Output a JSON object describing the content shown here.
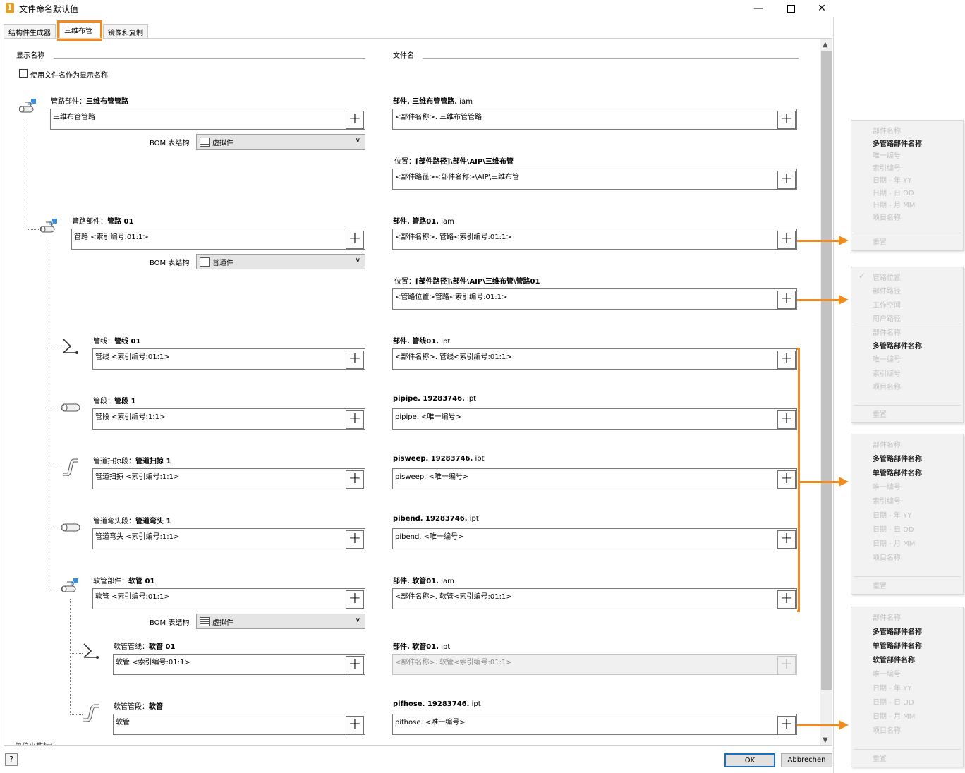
{
  "window": {
    "title": "文件命名默认值"
  },
  "tabs": [
    "结构件生成器",
    "三维布管",
    "镜像和复制"
  ],
  "header": {
    "display_name": "显示名称",
    "file_name": "文件名"
  },
  "use_filename_checkbox": "使用文件名作为显示名称",
  "rows": [
    {
      "label": "管路部件：",
      "label_bold": "三维布管管路",
      "value": "三维布管管路",
      "file_label": "部件. 三维布管管路.",
      "file_ext": "iam",
      "file_value": "<部件名称>. 三维布管管路",
      "icon": "assembly-icon"
    },
    {
      "label": "管路部件：",
      "label_bold": "管路 01",
      "value": "管路 <索引编号:01:1>",
      "file_label": "部件. 管路01.",
      "file_ext": "iam",
      "file_value": "<部件名称>. 管路<索引编号:01:1>",
      "icon": "assembly-icon"
    },
    {
      "label": "管线：",
      "label_bold": "管线 01",
      "value": "管线 <索引编号:01:1>",
      "file_label": "部件. 管线01.",
      "file_ext": "ipt",
      "file_value": "<部件名称>. 管线<索引编号:01:1>",
      "icon": "route-icon"
    },
    {
      "label": "管段：",
      "label_bold": "管段 1",
      "value": "管段 <索引编号:1:1>",
      "file_label": "pipipe. 19283746.",
      "file_ext": "ipt",
      "file_value": "pipipe. <唯一编号>",
      "icon": "pipe-icon"
    },
    {
      "label": "管道扫掠段：",
      "label_bold": "管道扫掠 1",
      "value": "管道扫掠 <索引编号:1:1>",
      "file_label": "pisweep. 19283746.",
      "file_ext": "ipt",
      "file_value": "pisweep. <唯一编号>",
      "icon": "sweep-icon"
    },
    {
      "label": "管道弯头段：",
      "label_bold": "管道弯头 1",
      "value": "管道弯头 <索引编号:1:1>",
      "file_label": "pibend. 19283746.",
      "file_ext": "ipt",
      "file_value": "pibend. <唯一编号>",
      "icon": "pipe-icon"
    },
    {
      "label": "软管部件：",
      "label_bold": "软管 01",
      "value": "软管 <索引编号:01:1>",
      "file_label": "部件. 软管01.",
      "file_ext": "iam",
      "file_value": "<部件名称>. 软管<索引编号:01:1>",
      "icon": "assembly-icon"
    },
    {
      "label": "软管管线：",
      "label_bold": "软管 01",
      "value": "软管 <索引编号:01:1>",
      "file_label": "部件. 软管01.",
      "file_ext": "ipt",
      "file_value": "<部件名称>. 软管<索引编号:01:1>",
      "icon": "route-icon"
    },
    {
      "label": "软管管段：",
      "label_bold": "软管",
      "value": "软管",
      "file_label": "pifhose. 19283746.",
      "file_ext": "ipt",
      "file_value": "pifhose. <唯一编号>",
      "icon": "sweep-icon"
    }
  ],
  "bom": [
    {
      "label": "BOM 表结构",
      "value": "虚拟件"
    },
    {
      "label": "BOM 表结构",
      "value": "普通件"
    },
    {
      "label": "BOM 表结构",
      "value": "虚拟件"
    }
  ],
  "locations": [
    {
      "label_prefix": "位置：",
      "label_bold": "[部件路径]\\部件\\AIP\\三维布管",
      "value": "<部件路径><部件名称>\\AIP\\三维布管"
    },
    {
      "label_prefix": "位置：",
      "label_bold": "[部件路径]\\部件\\AIP\\三维布管\\管路01",
      "value": "<管路位置>管路<索引编号:01:1>"
    }
  ],
  "cut_text": "单位小数标记",
  "footer": {
    "help": "?",
    "ok": "OK",
    "cancel": "Abbrechen"
  },
  "menus": [
    {
      "items": [
        "部件名称",
        "多管路部件名称",
        "唯一编号",
        "索引编号",
        "日期 - 年 YY",
        "日期 - 日 DD",
        "日期 - 月 MM",
        "项目名称",
        "重置"
      ],
      "enabled": [
        false,
        true,
        false,
        false,
        false,
        false,
        false,
        false,
        false
      ]
    },
    {
      "items": [
        "管路位置",
        "部件路径",
        "工作空间",
        "用户路径",
        "部件名称",
        "多管路部件名称",
        "唯一编号",
        "索引编号",
        "项目名称",
        "重置"
      ],
      "enabled": [
        false,
        false,
        false,
        false,
        false,
        true,
        false,
        false,
        false,
        false
      ]
    },
    {
      "items": [
        "部件名称",
        "多管路部件名称",
        "单管路部件名称",
        "唯一编号",
        "索引编号",
        "日期 - 年 YY",
        "日期 - 日 DD",
        "日期 - 月 MM",
        "项目名称",
        "重置"
      ],
      "enabled": [
        false,
        true,
        true,
        false,
        false,
        false,
        false,
        false,
        false,
        false
      ]
    },
    {
      "items": [
        "部件名称",
        "多管路部件名称",
        "单管路部件名称",
        "软管部件名称",
        "唯一编号",
        "日期 - 年 YY",
        "日期 - 日 DD",
        "日期 - 月 MM",
        "项目名称",
        "重置"
      ],
      "enabled": [
        false,
        true,
        true,
        true,
        false,
        false,
        false,
        false,
        false,
        false
      ]
    }
  ],
  "colors": {
    "highlight": "#f08c1e",
    "menu_bg": "#f2f2f2",
    "disabled_text": "#c4c4c4"
  }
}
